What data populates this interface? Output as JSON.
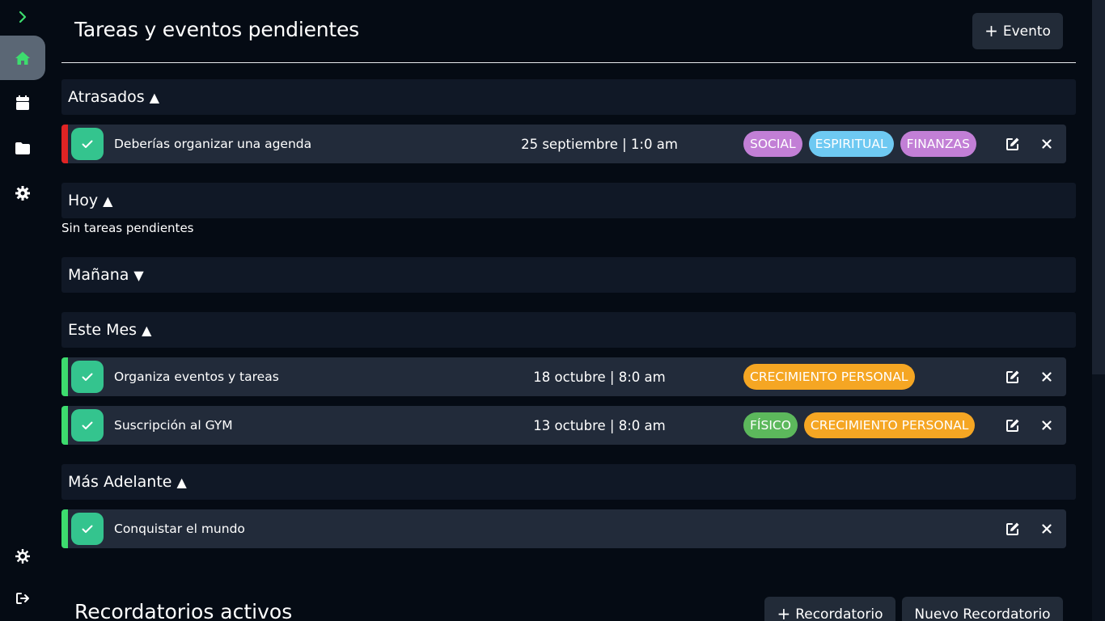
{
  "page": {
    "title": "Tareas y eventos pendientes",
    "add_event_label": "Evento",
    "reminders_title": "Recordatorios activos",
    "add_reminder_label": "Recordatorio",
    "new_reminder_label": "Nuevo Recordatorio"
  },
  "sections": {
    "overdue": {
      "label": "Atrasados",
      "arrow": "▲"
    },
    "today": {
      "label": "Hoy",
      "arrow": "▲",
      "empty": "Sin tareas pendientes"
    },
    "tomorrow": {
      "label": "Mañana",
      "arrow": "▼"
    },
    "month": {
      "label": "Este Mes",
      "arrow": "▲"
    },
    "later": {
      "label": "Más Adelante",
      "arrow": "▲"
    }
  },
  "tasks": {
    "overdue": [
      {
        "name": "Deberías organizar una agenda",
        "date": "25 septiembre | 1:0 am",
        "bar_color": "#e02424",
        "tags": [
          {
            "label": "SOCIAL",
            "color": "#c27fd6"
          },
          {
            "label": "ESPIRITUAL",
            "color": "#6ec9f2"
          },
          {
            "label": "FINANZAS",
            "color": "#c27fd6"
          }
        ]
      }
    ],
    "month": [
      {
        "name": "Organiza eventos y tareas",
        "date": "18 octubre | 8:0 am",
        "bar_color": "#3ddc6e",
        "tags": [
          {
            "label": "CRECIMIENTO PERSONAL",
            "color": "#f5a623"
          }
        ]
      },
      {
        "name": "Suscripción al GYM",
        "date": "13 octubre | 8:0 am",
        "bar_color": "#3ddc6e",
        "tags": [
          {
            "label": "FÍSICO",
            "color": "#5cb85c"
          },
          {
            "label": "CRECIMIENTO PERSONAL",
            "color": "#f5a623"
          }
        ]
      }
    ],
    "later": [
      {
        "name": "Conquistar el mundo",
        "date": "",
        "bar_color": "#3ddc6e",
        "tags": []
      }
    ]
  },
  "sidebar": {
    "expand_icon": "chevron-right-icon",
    "items": [
      {
        "icon": "home-icon",
        "active": true
      },
      {
        "icon": "calendar-icon",
        "active": false
      },
      {
        "icon": "folder-icon",
        "active": false
      },
      {
        "icon": "gear-icon",
        "active": false
      }
    ],
    "bottom": [
      {
        "icon": "sun-gear-icon"
      },
      {
        "icon": "logout-icon"
      }
    ]
  },
  "colors": {
    "background": "#050b14",
    "section_header": "#101826",
    "task_row": "#222b3a",
    "check": "#34c48e",
    "accent_green": "#3ddc6e",
    "overdue_red": "#e02424"
  }
}
